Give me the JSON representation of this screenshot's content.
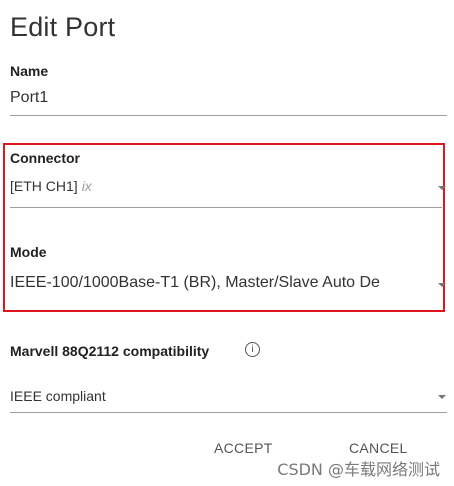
{
  "dialog": {
    "title": "Edit Port",
    "name_field": {
      "label": "Name",
      "value": "Port1"
    },
    "connector_field": {
      "label": "Connector",
      "value": "[ETH CH1]",
      "suffix": "ix"
    },
    "mode_field": {
      "label": "Mode",
      "value": "IEEE-100/1000Base-T1 (BR), Master/Slave Auto De"
    },
    "compat_field": {
      "label": "Marvell 88Q2112 compatibility",
      "info_glyph": "i",
      "value": "IEEE compliant"
    },
    "actions": {
      "accept": "ACCEPT",
      "cancel": "CANCEL"
    },
    "highlight_color": "#e0161e"
  },
  "watermark": "CSDN @车载网络测试"
}
